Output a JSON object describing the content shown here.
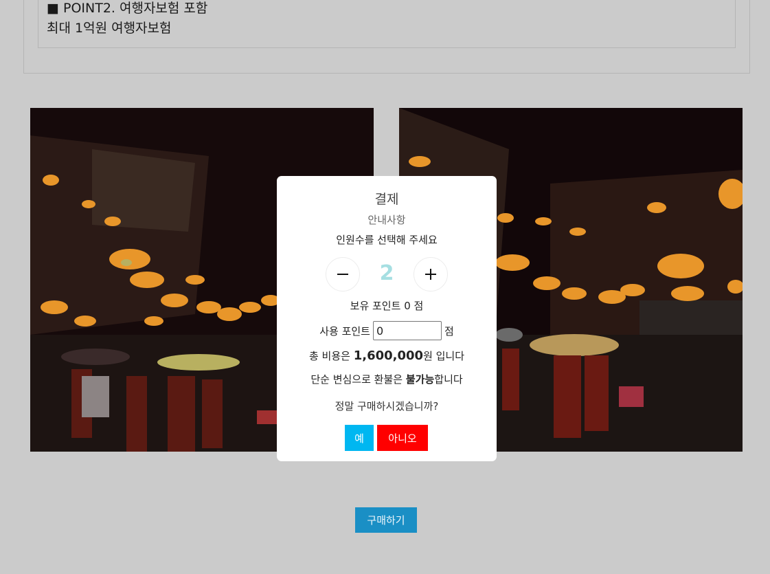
{
  "info_panel": {
    "point_title": "■ POINT2. 여행자보험 포함",
    "point_desc": "최대 1억원 여행자보험"
  },
  "photos": [
    {
      "name": "night-market-photo-left"
    },
    {
      "name": "night-market-photo-right"
    }
  ],
  "modal": {
    "title": "결제",
    "subtitle": "안내사항",
    "guide": "인원수를 선택해 주세요",
    "count": "2",
    "owned_points_prefix": "보유 포인트",
    "owned_points_value": "0",
    "owned_points_unit": "점",
    "use_points_label": "사용 포인트",
    "use_points_value": "0",
    "use_points_unit": "점",
    "total_prefix": "총 비용은",
    "total_amount": "1,600,000",
    "total_suffix": "원 입니다",
    "refund_prefix": "단순 변심으로 환불은",
    "refund_emphasis": "불가능",
    "refund_suffix": "합니다",
    "confirm_question": "정말 구매하시겠습니까?",
    "yes_label": "예",
    "no_label": "아니오",
    "icons": {
      "minus": "minus-icon",
      "plus": "plus-icon"
    }
  },
  "buy_button_label": "구매하기",
  "colors": {
    "overlay_bg": "#cbcbcb",
    "count_color": "#a6dfe2",
    "yes_button": "#00b7f1",
    "no_button": "#ff0000",
    "buy_button": "#1a8fc5"
  }
}
